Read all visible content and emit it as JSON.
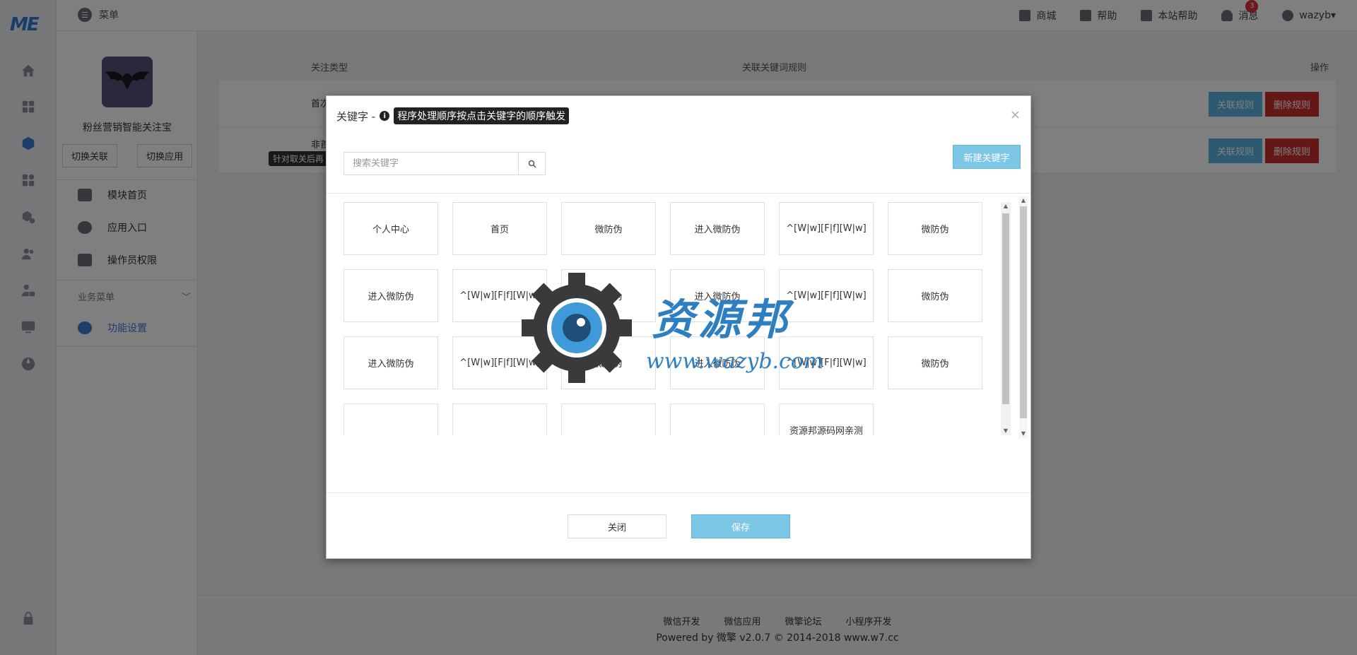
{
  "brand": {
    "logo_text": "ME"
  },
  "rail": {
    "icons": [
      "home-icon",
      "grid-icon",
      "cube-icon",
      "apps-icon",
      "module-icon",
      "users-icon",
      "user-lock-icon",
      "monitor-icon",
      "globe-icon",
      "lock-icon"
    ]
  },
  "topbar": {
    "menu_label": "菜单",
    "nav": [
      {
        "label": "商城",
        "icon": "shop-icon"
      },
      {
        "label": "帮助",
        "icon": "help-icon"
      },
      {
        "label": "本站帮助",
        "icon": "site-help-icon"
      },
      {
        "label": "消息",
        "icon": "bell-icon",
        "badge": "3"
      },
      {
        "label": "wazyb▾",
        "icon": "user-icon"
      }
    ]
  },
  "sidebar": {
    "app_name": "粉丝营销智能关注宝",
    "switch_link": "切换关联",
    "switch_app": "切换应用",
    "items": [
      {
        "label": "模块首页"
      },
      {
        "label": "应用入口"
      },
      {
        "label": "操作员权限"
      }
    ],
    "group_label": "业务菜单",
    "active_item": "功能设置"
  },
  "table": {
    "headers": [
      "关注类型",
      "关联关键词规则",
      "操作"
    ],
    "rows": [
      {
        "type": "首次"
      },
      {
        "type": "非首",
        "tip": "针对取关后再"
      }
    ],
    "action_link": "关联规则",
    "action_delete": "删除规则"
  },
  "modal": {
    "title": "关键字 -",
    "tip": "程序处理顺序按点击关键字的顺序触发",
    "search_placeholder": "搜索关键字",
    "new_button": "新建关键字",
    "keywords": [
      "个人中心",
      "首页",
      "微防伪",
      "进入微防伪",
      "^[W|w][F|f][W|w]",
      "微防伪",
      "进入微防伪",
      "^[W|w][F|f][W|w]",
      "微防伪",
      "进入微防伪",
      "^[W|w][F|f][W|w]",
      "微防伪",
      "进入微防伪",
      "^[W|w][F|f][W|w]",
      "微防伪",
      "进入微防伪",
      "^[W|w][F|f][W|w]",
      "微防伪",
      "",
      "",
      "",
      "",
      "资源邦源码网亲测"
    ],
    "close_button": "关闭",
    "save_button": "保存"
  },
  "footer": {
    "links": [
      "微信开发",
      "微信应用",
      "微擎论坛",
      "小程序开发"
    ],
    "powered": "Powered by 微擎 v2.0.7 © 2014-2018 www.w7.cc"
  },
  "watermark": {
    "title": "资源邦",
    "url": "www.wazyb.com"
  }
}
